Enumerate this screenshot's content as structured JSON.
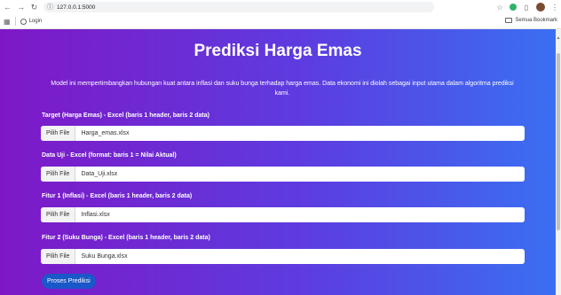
{
  "browser": {
    "url": "127.0.0.1:5000",
    "bookmark_login": "Login",
    "all_bookmarks": "Semua Bookmark"
  },
  "page": {
    "title": "Prediksi Harga Emas",
    "description": "Model ini mempertimbangkan hubungan kuat antara inflasi dan suku bunga terhadap harga emas. Data ekonomi ini diolah sebagai input utama dalam algoritma prediksi kami.",
    "fields": [
      {
        "label": "Target (Harga Emas) - Excel (baris 1 header, baris 2 data)",
        "button": "Pilih File",
        "filename": "Harga_emas.xlsx"
      },
      {
        "label": "Data Uji - Excel (format: baris 1 = Nilai Aktual)",
        "button": "Pilih File",
        "filename": "Data_Uji.xlsx"
      },
      {
        "label": "Fitur 1 (Inflasi) - Excel (baris 1 header, baris 2 data)",
        "button": "Pilih File",
        "filename": "Inflasi.xlsx"
      },
      {
        "label": "Fitur 2 (Suku Bunga) - Excel (baris 1 header, baris 2 data)",
        "button": "Pilih File",
        "filename": "Suku Bunga.xlsx"
      }
    ],
    "submit_label": "Proses Prediksi"
  },
  "colors": {
    "gradient_start": "#7e18c6",
    "gradient_end": "#3a6ff2",
    "submit_button": "#1a57c9"
  }
}
